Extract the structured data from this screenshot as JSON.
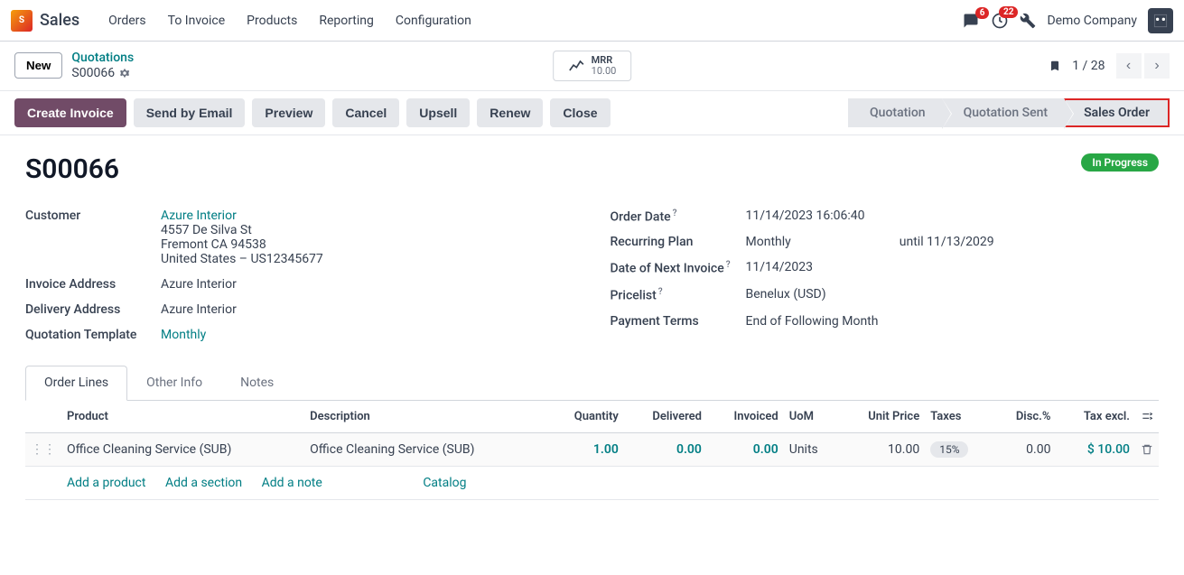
{
  "nav": {
    "app": "Sales",
    "items": [
      "Orders",
      "To Invoice",
      "Products",
      "Reporting",
      "Configuration"
    ],
    "company": "Demo Company",
    "msg_count": "6",
    "act_count": "22"
  },
  "control": {
    "new_btn": "New",
    "breadcrumb_root": "Quotations",
    "breadcrumb_current": "S00066",
    "mrr_label": "MRR",
    "mrr_value": "10.00",
    "pager": "1 / 28"
  },
  "statusbar": {
    "buttons": [
      "Create Invoice",
      "Send by Email",
      "Preview",
      "Cancel",
      "Upsell",
      "Renew",
      "Close"
    ],
    "steps": [
      "Quotation",
      "Quotation Sent",
      "Sales Order"
    ]
  },
  "record": {
    "name": "S00066",
    "status_badge": "In Progress",
    "left": {
      "customer_label": "Customer",
      "customer_name": "Azure Interior",
      "addr1": "4557 De Silva St",
      "addr2": "Fremont CA 94538",
      "addr3": "United States – US12345677",
      "invoice_addr_label": "Invoice Address",
      "invoice_addr": "Azure Interior",
      "delivery_addr_label": "Delivery Address",
      "delivery_addr": "Azure Interior",
      "quote_tmpl_label": "Quotation Template",
      "quote_tmpl": "Monthly"
    },
    "right": {
      "order_date_label": "Order Date",
      "order_date": "11/14/2023 16:06:40",
      "recurring_label": "Recurring Plan",
      "recurring": "Monthly",
      "until_label": "until",
      "until_date": "11/13/2029",
      "next_inv_label": "Date of Next Invoice",
      "next_inv": "11/14/2023",
      "pricelist_label": "Pricelist",
      "pricelist": "Benelux (USD)",
      "payterm_label": "Payment Terms",
      "payterm": "End of Following Month"
    }
  },
  "tabs": [
    "Order Lines",
    "Other Info",
    "Notes"
  ],
  "table": {
    "headers": {
      "product": "Product",
      "description": "Description",
      "quantity": "Quantity",
      "delivered": "Delivered",
      "invoiced": "Invoiced",
      "uom": "UoM",
      "unit_price": "Unit Price",
      "taxes": "Taxes",
      "disc": "Disc.%",
      "tax_excl": "Tax excl."
    },
    "row": {
      "product": "Office Cleaning Service (SUB)",
      "description": "Office Cleaning Service (SUB)",
      "quantity": "1.00",
      "delivered": "0.00",
      "invoiced": "0.00",
      "uom": "Units",
      "unit_price": "10.00",
      "tax": "15%",
      "disc": "0.00",
      "tax_excl": "$ 10.00"
    },
    "add_product": "Add a product",
    "add_section": "Add a section",
    "add_note": "Add a note",
    "catalog": "Catalog"
  }
}
